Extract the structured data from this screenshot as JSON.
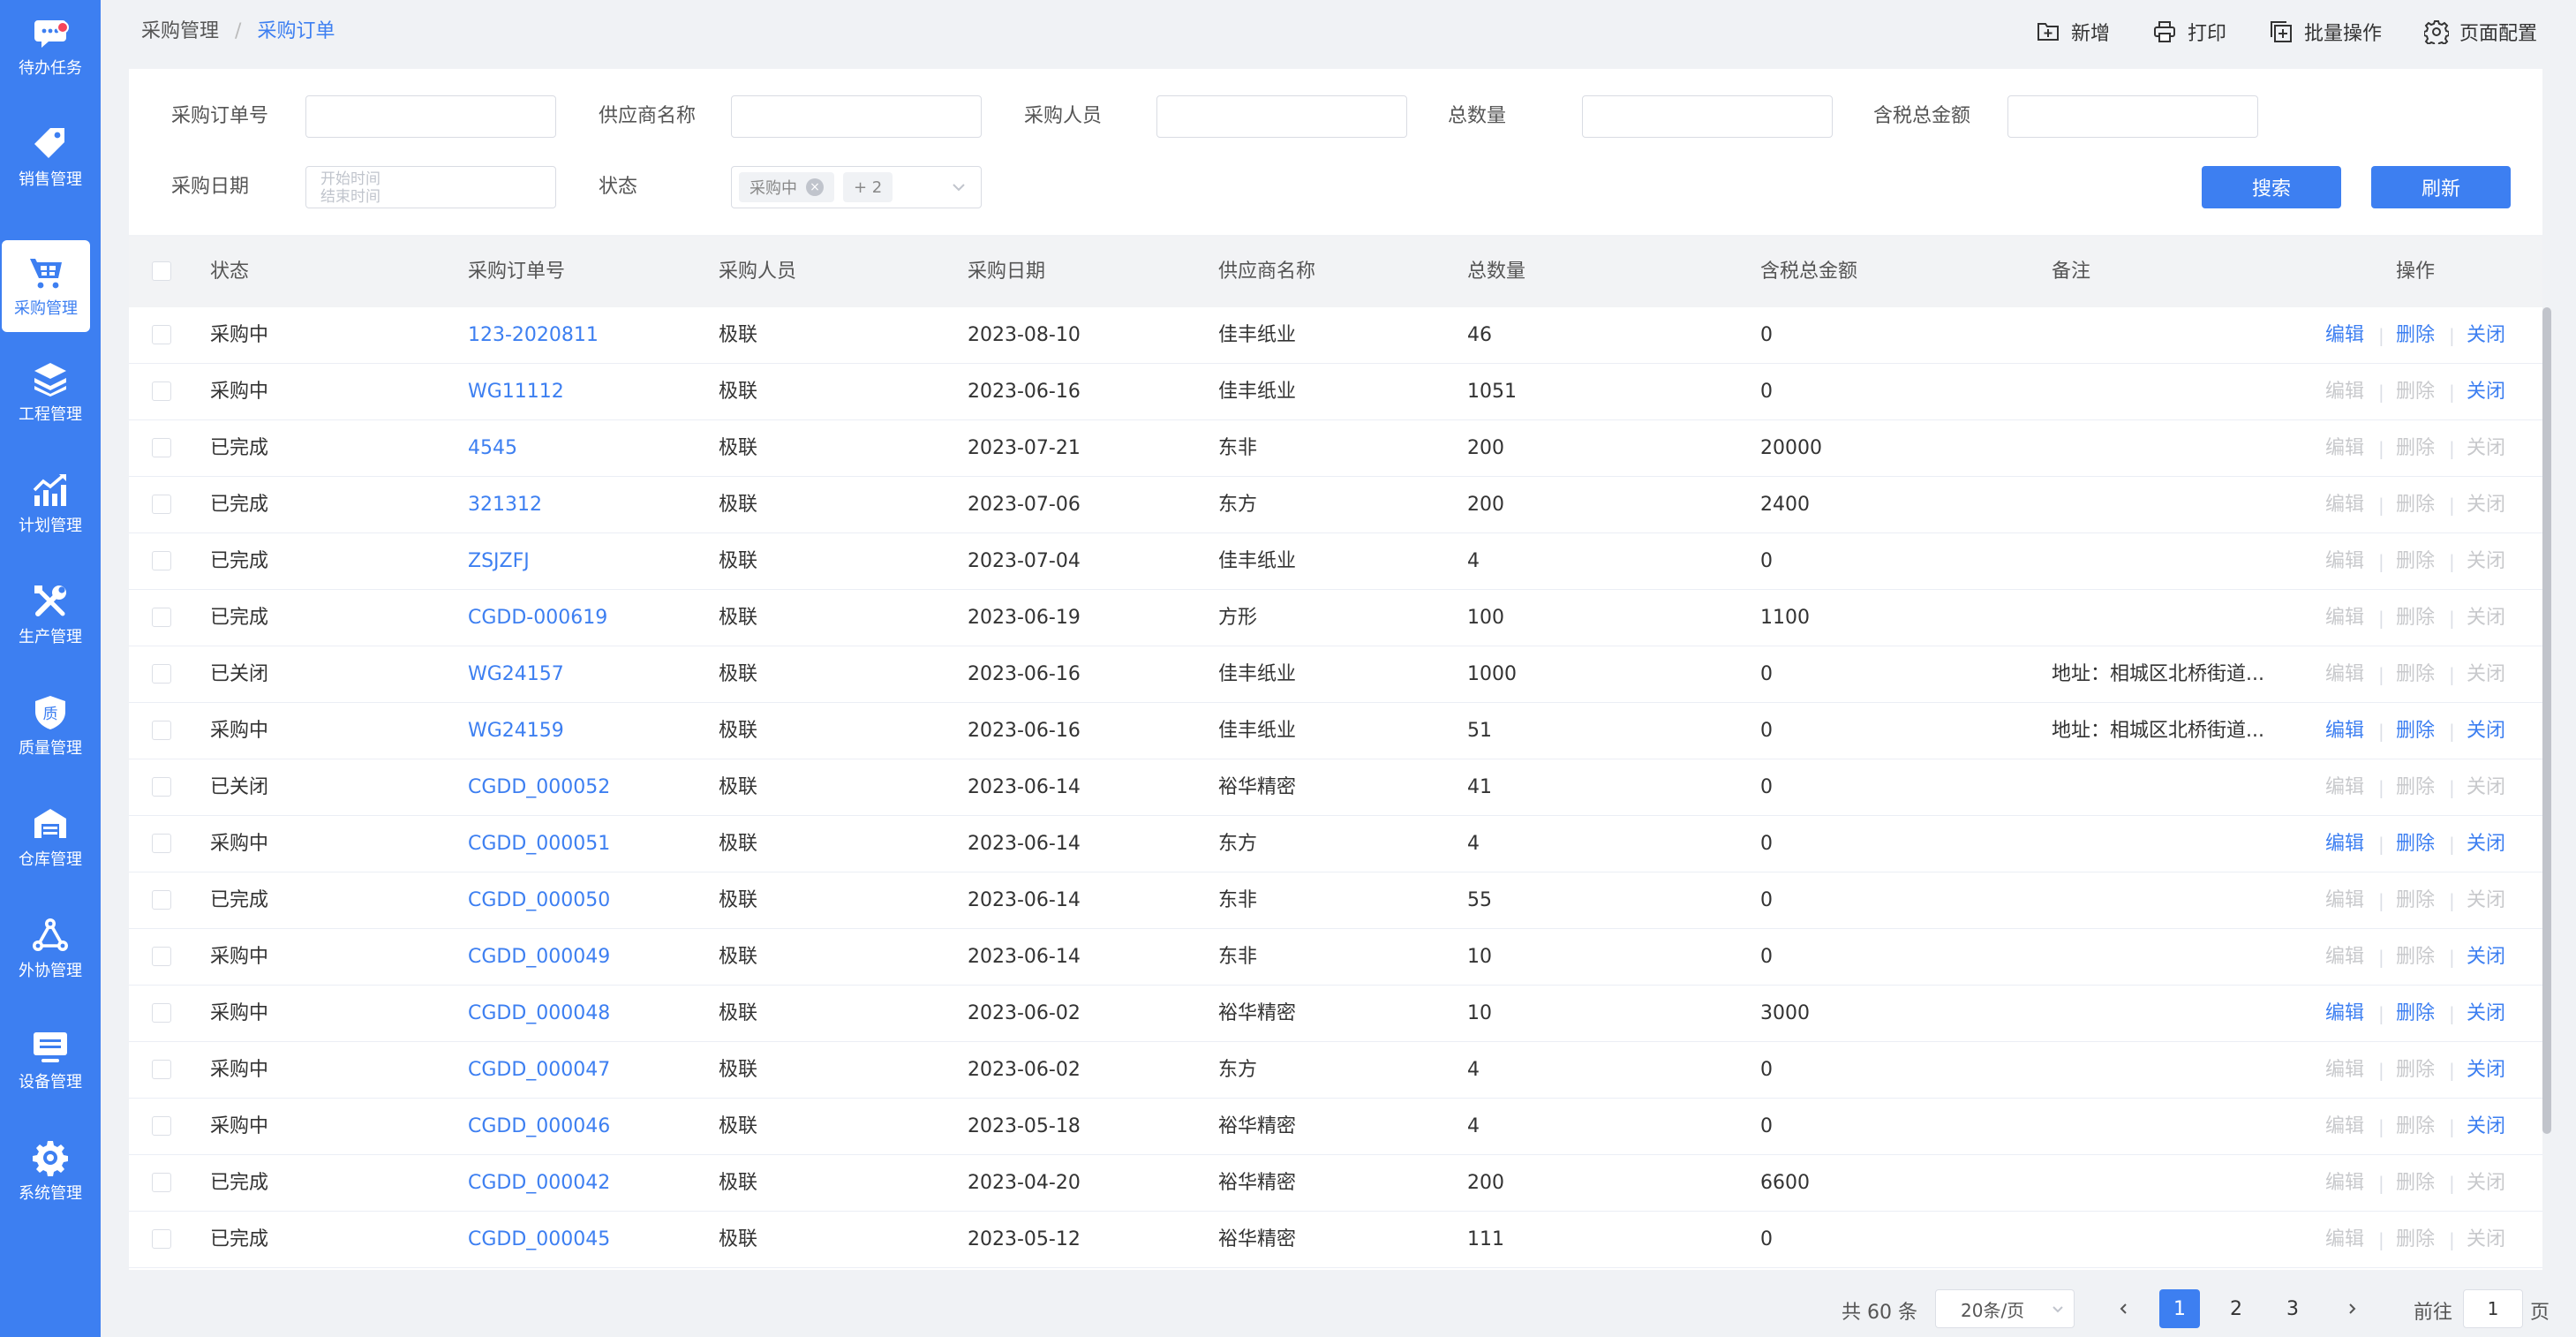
{
  "sidebar": {
    "items": [
      {
        "label": "待办任务",
        "icon": "chat-icon",
        "badge": true
      },
      {
        "label": "销售管理",
        "icon": "tag-icon"
      },
      {
        "label": "采购管理",
        "icon": "cart-icon",
        "active": true
      },
      {
        "label": "工程管理",
        "icon": "layers-icon"
      },
      {
        "label": "计划管理",
        "icon": "chart-icon"
      },
      {
        "label": "生产管理",
        "icon": "tools-icon"
      },
      {
        "label": "质量管理",
        "icon": "shield-icon",
        "glyph": "质"
      },
      {
        "label": "仓库管理",
        "icon": "warehouse-icon"
      },
      {
        "label": "外协管理",
        "icon": "network-icon"
      },
      {
        "label": "设备管理",
        "icon": "monitor-icon"
      },
      {
        "label": "系统管理",
        "icon": "gear-icon"
      }
    ],
    "accent": "#3d7ff1"
  },
  "breadcrumb": {
    "parent": "采购管理",
    "separator": "/",
    "current": "采购订单"
  },
  "toolbar": {
    "add": "新增",
    "print": "打印",
    "batch": "批量操作",
    "config": "页面配置"
  },
  "filters": {
    "order_no": "采购订单号",
    "supplier": "供应商名称",
    "buyer": "采购人员",
    "total_qty": "总数量",
    "tax_amount": "含税总金额",
    "date": "采购日期",
    "date_start": "开始时间",
    "date_end": "结束时间",
    "status": "状态",
    "status_tag": "采购中",
    "status_more": "+ 2",
    "search_btn": "搜索",
    "refresh_btn": "刷新"
  },
  "table": {
    "headers": {
      "status": "状态",
      "order_no": "采购订单号",
      "buyer": "采购人员",
      "date": "采购日期",
      "supplier": "供应商名称",
      "qty": "总数量",
      "amount": "含税总金额",
      "remark": "备注",
      "actions": "操作"
    },
    "action_labels": {
      "edit": "编辑",
      "delete": "删除",
      "close": "关闭"
    },
    "rows": [
      {
        "status": "采购中",
        "order_no": "123-2020811",
        "buyer": "极联",
        "date": "2023-08-10",
        "supplier": "佳丰纸业",
        "qty": "46",
        "amount": "0",
        "remark": "",
        "edit": true,
        "del": true,
        "close": true
      },
      {
        "status": "采购中",
        "order_no": "WG11112",
        "buyer": "极联",
        "date": "2023-06-16",
        "supplier": "佳丰纸业",
        "qty": "1051",
        "amount": "0",
        "remark": "",
        "edit": false,
        "del": false,
        "close": true
      },
      {
        "status": "已完成",
        "order_no": "4545",
        "buyer": "极联",
        "date": "2023-07-21",
        "supplier": "东非",
        "qty": "200",
        "amount": "20000",
        "remark": "",
        "edit": false,
        "del": false,
        "close": false
      },
      {
        "status": "已完成",
        "order_no": "321312",
        "buyer": "极联",
        "date": "2023-07-06",
        "supplier": "东方",
        "qty": "200",
        "amount": "2400",
        "remark": "",
        "edit": false,
        "del": false,
        "close": false
      },
      {
        "status": "已完成",
        "order_no": "ZSJZFJ",
        "buyer": "极联",
        "date": "2023-07-04",
        "supplier": "佳丰纸业",
        "qty": "4",
        "amount": "0",
        "remark": "",
        "edit": false,
        "del": false,
        "close": false
      },
      {
        "status": "已完成",
        "order_no": "CGDD-000619",
        "buyer": "极联",
        "date": "2023-06-19",
        "supplier": "方形",
        "qty": "100",
        "amount": "1100",
        "remark": "",
        "edit": false,
        "del": false,
        "close": false
      },
      {
        "status": "已关闭",
        "order_no": "WG24157",
        "buyer": "极联",
        "date": "2023-06-16",
        "supplier": "佳丰纸业",
        "qty": "1000",
        "amount": "0",
        "remark": "地址：相城区北桥街道...",
        "edit": false,
        "del": false,
        "close": false
      },
      {
        "status": "采购中",
        "order_no": "WG24159",
        "buyer": "极联",
        "date": "2023-06-16",
        "supplier": "佳丰纸业",
        "qty": "51",
        "amount": "0",
        "remark": "地址：相城区北桥街道...",
        "edit": true,
        "del": true,
        "close": true
      },
      {
        "status": "已关闭",
        "order_no": "CGDD_000052",
        "buyer": "极联",
        "date": "2023-06-14",
        "supplier": "裕华精密",
        "qty": "41",
        "amount": "0",
        "remark": "",
        "edit": false,
        "del": false,
        "close": false
      },
      {
        "status": "采购中",
        "order_no": "CGDD_000051",
        "buyer": "极联",
        "date": "2023-06-14",
        "supplier": "东方",
        "qty": "4",
        "amount": "0",
        "remark": "",
        "edit": true,
        "del": true,
        "close": true
      },
      {
        "status": "已完成",
        "order_no": "CGDD_000050",
        "buyer": "极联",
        "date": "2023-06-14",
        "supplier": "东非",
        "qty": "55",
        "amount": "0",
        "remark": "",
        "edit": false,
        "del": false,
        "close": false
      },
      {
        "status": "采购中",
        "order_no": "CGDD_000049",
        "buyer": "极联",
        "date": "2023-06-14",
        "supplier": "东非",
        "qty": "10",
        "amount": "0",
        "remark": "",
        "edit": false,
        "del": false,
        "close": true
      },
      {
        "status": "采购中",
        "order_no": "CGDD_000048",
        "buyer": "极联",
        "date": "2023-06-02",
        "supplier": "裕华精密",
        "qty": "10",
        "amount": "3000",
        "remark": "",
        "edit": true,
        "del": true,
        "close": true
      },
      {
        "status": "采购中",
        "order_no": "CGDD_000047",
        "buyer": "极联",
        "date": "2023-06-02",
        "supplier": "东方",
        "qty": "4",
        "amount": "0",
        "remark": "",
        "edit": false,
        "del": false,
        "close": true
      },
      {
        "status": "采购中",
        "order_no": "CGDD_000046",
        "buyer": "极联",
        "date": "2023-05-18",
        "supplier": "裕华精密",
        "qty": "4",
        "amount": "0",
        "remark": "",
        "edit": false,
        "del": false,
        "close": true
      },
      {
        "status": "已完成",
        "order_no": "CGDD_000042",
        "buyer": "极联",
        "date": "2023-04-20",
        "supplier": "裕华精密",
        "qty": "200",
        "amount": "6600",
        "remark": "",
        "edit": false,
        "del": false,
        "close": false
      },
      {
        "status": "已完成",
        "order_no": "CGDD_000045",
        "buyer": "极联",
        "date": "2023-05-12",
        "supplier": "裕华精密",
        "qty": "111",
        "amount": "0",
        "remark": "",
        "edit": false,
        "del": false,
        "close": false
      }
    ]
  },
  "pagination": {
    "total": "共 60 条",
    "page_size": "20条/页",
    "pages": [
      "1",
      "2",
      "3"
    ],
    "current": "1",
    "goto_label": "前往",
    "goto_value": "1",
    "page_suffix": "页"
  }
}
